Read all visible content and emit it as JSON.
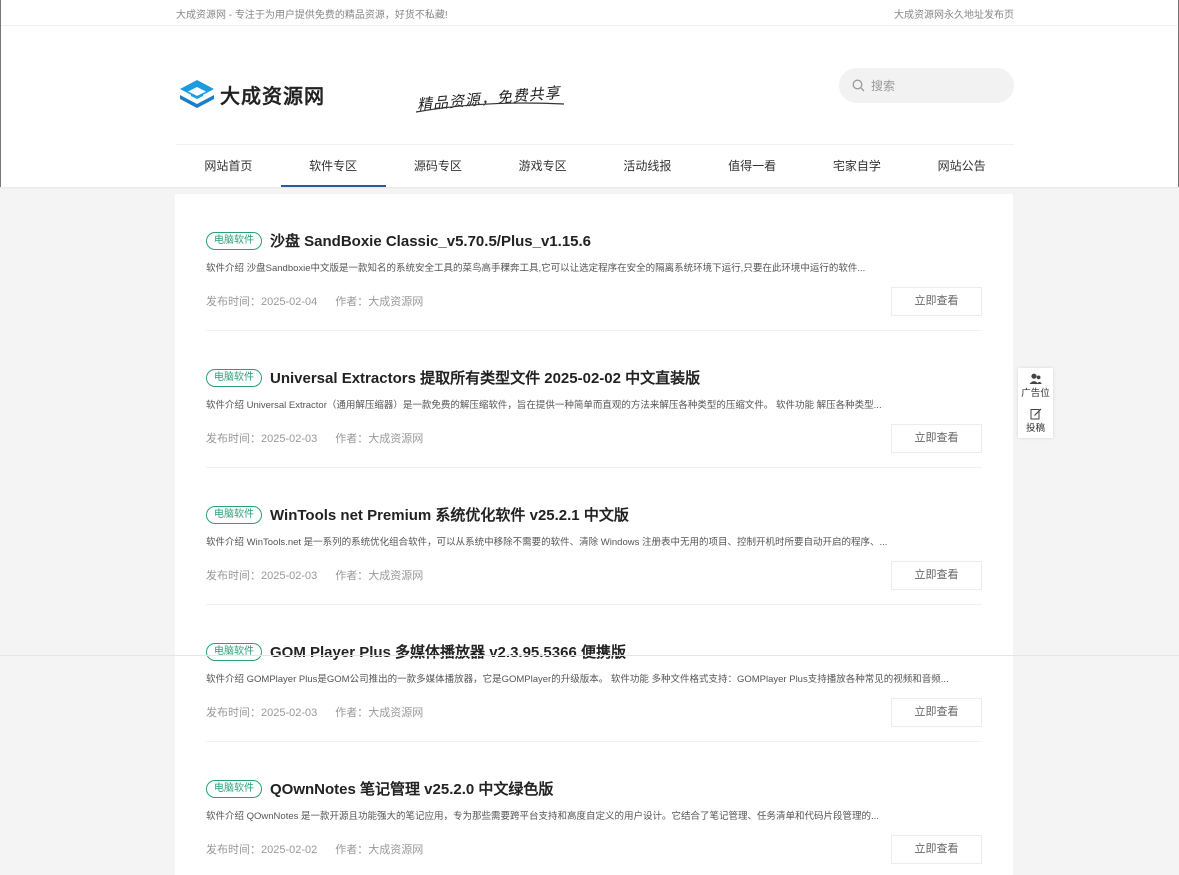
{
  "topbar": {
    "tagline": "大成资源网 - 专注于为用户提供免费的精品资源，好货不私藏!",
    "permanent_link": "大成资源网永久地址发布页"
  },
  "brand": {
    "logo_text": "大成资源网",
    "slogan": "精品资源，免费共享"
  },
  "search": {
    "placeholder": "搜索"
  },
  "nav": {
    "items": [
      {
        "label": "网站首页"
      },
      {
        "label": "软件专区"
      },
      {
        "label": "源码专区"
      },
      {
        "label": "游戏专区"
      },
      {
        "label": "活动线报"
      },
      {
        "label": "值得一看"
      },
      {
        "label": "宅家自学"
      },
      {
        "label": "网站公告"
      }
    ],
    "active": "软件专区"
  },
  "posts": [
    {
      "badge": "电脑软件",
      "title": "沙盘 SandBoxie Classic_v5.70.5/Plus_v1.15.6",
      "excerpt": "软件介绍 沙盘Sandboxie中文版是一款知名的系统安全工具的菜鸟高手稞奔工具,它可以让选定程序在安全的隔离系统环境下运行,只要在此环境中运行的软件...",
      "date": "发布时间：2025-02-04",
      "author": "作者：大成资源网",
      "button": "立即查看"
    },
    {
      "badge": "电脑软件",
      "title": "Universal Extractors 提取所有类型文件 2025-02-02 中文直装版",
      "excerpt": "软件介绍 Universal Extractor（通用解压缩器）是一款免费的解压缩软件，旨在提供一种简单而直观的方法来解压各种类型的压缩文件。 软件功能 解压各种类型...",
      "date": "发布时间：2025-02-03",
      "author": "作者：大成资源网",
      "button": "立即查看"
    },
    {
      "badge": "电脑软件",
      "title": "WinTools net Premium 系统优化软件 v25.2.1 中文版",
      "excerpt": "软件介绍 WinTools.net 是一系列的系统优化组合软件，可以从系统中移除不需要的软件、清除 Windows 注册表中无用的项目、控制开机时所要自动开启的程序、...",
      "date": "发布时间：2025-02-03",
      "author": "作者：大成资源网",
      "button": "立即查看"
    },
    {
      "badge": "电脑软件",
      "title": "GOM Player Plus 多媒体播放器 v2.3.95.5366 便携版",
      "excerpt": "软件介绍 GOMPlayer Plus是GOM公司推出的一款多媒体播放器，它是GOMPlayer的升级版本。 软件功能 多种文件格式支持：GOMPlayer Plus支持播放各种常见的视频和音频...",
      "date": "发布时间：2025-02-03",
      "author": "作者：大成资源网",
      "button": "立即查看"
    },
    {
      "badge": "电脑软件",
      "title": "QOwnNotes 笔记管理 v25.2.0 中文绿色版",
      "excerpt": "软件介绍 QOwnNotes 是一款开源且功能强大的笔记应用，专为那些需要跨平台支持和高度自定义的用户设计。它结合了笔记管理、任务清单和代码片段管理的...",
      "date": "发布时间：2025-02-02",
      "author": "作者：大成资源网",
      "button": "立即查看"
    }
  ],
  "side": {
    "ad_label": "广告位",
    "submit_label": "投稿"
  },
  "colors": {
    "accent": "#2a5aa6",
    "badge": "#2e9e77",
    "logo_blue": "#1c9be0"
  }
}
